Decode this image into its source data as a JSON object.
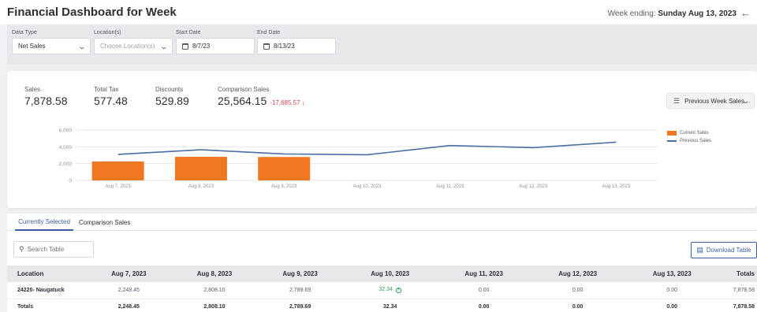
{
  "header": {
    "title": "Financial Dashboard for Week",
    "week_ending_label": "Week ending:",
    "week_ending_value": "Sunday Aug 13, 2023"
  },
  "filters": {
    "data_type": {
      "label": "Data Type",
      "value": "Net Sales"
    },
    "locations": {
      "label": "Location(s)",
      "placeholder": "Choose Location(s)"
    },
    "start_date": {
      "label": "Start Date",
      "value": "8/7/23"
    },
    "end_date": {
      "label": "End Date",
      "value": "8/13/23"
    }
  },
  "summary": {
    "sales": {
      "label": "Sales",
      "value": "7,878.58"
    },
    "total_tax": {
      "label": "Total Tax",
      "value": "577.48"
    },
    "discounts": {
      "label": "Discounts",
      "value": "529.89"
    },
    "comparison": {
      "label": "Comparison Sales",
      "value": "25,564.15",
      "delta": "-17,685.57"
    },
    "compare_dropdown": "Previous Week Sales"
  },
  "chart_data": {
    "type": "bar",
    "categories": [
      "Aug 7, 2023",
      "Aug 8, 2023",
      "Aug 9, 2023",
      "Aug 10, 2023",
      "Aug 11, 2023",
      "Aug 12, 2023",
      "Aug 13, 2023"
    ],
    "series": [
      {
        "name": "Current Sales",
        "type": "bar",
        "values": [
          2248.45,
          2808.1,
          2789.69,
          0,
          0,
          0,
          0
        ],
        "color": "#f07722"
      },
      {
        "name": "Previous Sales",
        "type": "line",
        "values": [
          3100,
          3650,
          3150,
          3050,
          4150,
          3900,
          4550
        ],
        "color": "#4a6fa5"
      }
    ],
    "yticks": [
      "6,000",
      "4,000",
      "2,000",
      "0"
    ],
    "ylim": [
      0,
      6000
    ],
    "grid": true,
    "legend": "right"
  },
  "tabs": [
    {
      "label": "Currently Selected",
      "active": true
    },
    {
      "label": "Comparison Sales",
      "active": false
    }
  ],
  "table": {
    "search_placeholder": "Search Table",
    "download_label": "Download Table",
    "columns": [
      "Location",
      "Aug 7, 2023",
      "Aug 8, 2023",
      "Aug 9, 2023",
      "Aug 10, 2023",
      "Aug 11, 2023",
      "Aug 12, 2023",
      "Aug 13, 2023",
      "Totals"
    ],
    "rows": [
      [
        "24220- Naugatuck",
        "2,248.45",
        "2,808.10",
        "2,789.69",
        "32.34",
        "0.00",
        "0.00",
        "0.00",
        "7,878.58"
      ]
    ],
    "totals": [
      "Totals",
      "2,248.45",
      "2,808.10",
      "2,789.69",
      "32.34",
      "0.00",
      "0.00",
      "0.00",
      "7,878.58"
    ]
  }
}
